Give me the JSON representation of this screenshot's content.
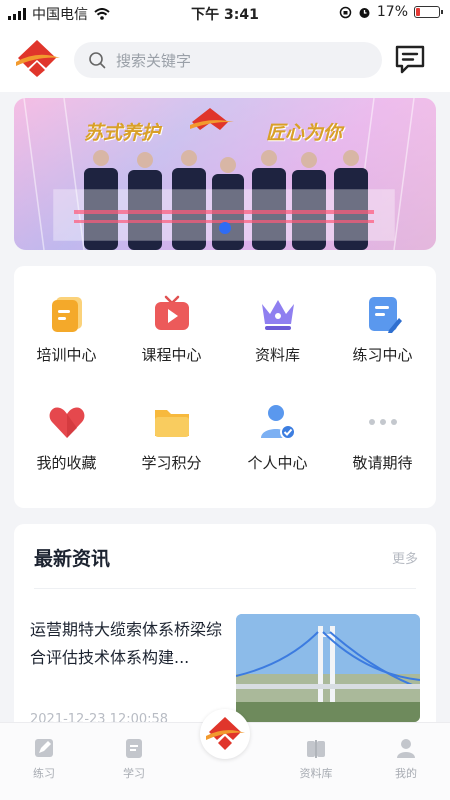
{
  "status_bar": {
    "carrier": "中国电信",
    "time": "下午 3:41",
    "battery": "17%",
    "battery_level": 0.17
  },
  "header": {
    "search_placeholder": "搜索关键字"
  },
  "banner": {
    "caption_left": "苏式养护",
    "caption_right": "匠心为你"
  },
  "grid": [
    {
      "label": "培训中心",
      "icon": "document-icon"
    },
    {
      "label": "课程中心",
      "icon": "video-play-icon"
    },
    {
      "label": "资料库",
      "icon": "crown-icon"
    },
    {
      "label": "练习中心",
      "icon": "edit-note-icon"
    },
    {
      "label": "我的收藏",
      "icon": "heart-icon"
    },
    {
      "label": "学习积分",
      "icon": "folder-icon"
    },
    {
      "label": "个人中心",
      "icon": "user-verified-icon"
    },
    {
      "label": "敬请期待",
      "icon": "more-dots-icon"
    }
  ],
  "news": {
    "title": "最新资讯",
    "more": "更多",
    "items": [
      {
        "title": "运营期特大缆索体系桥梁综合评估技术体系构建...",
        "date": "2021-12-23 12:00:58"
      }
    ]
  },
  "tabbar": [
    {
      "label": "练习",
      "icon": "pencil-icon"
    },
    {
      "label": "学习",
      "icon": "book-note-icon"
    },
    {
      "label": "",
      "icon": "home-logo-icon"
    },
    {
      "label": "资料库",
      "icon": "books-icon"
    },
    {
      "label": "我的",
      "icon": "person-icon"
    }
  ],
  "colors": {
    "brand_red": "#e0352b",
    "brand_orange": "#f29a2e",
    "accent_blue": "#4a8fe8"
  }
}
